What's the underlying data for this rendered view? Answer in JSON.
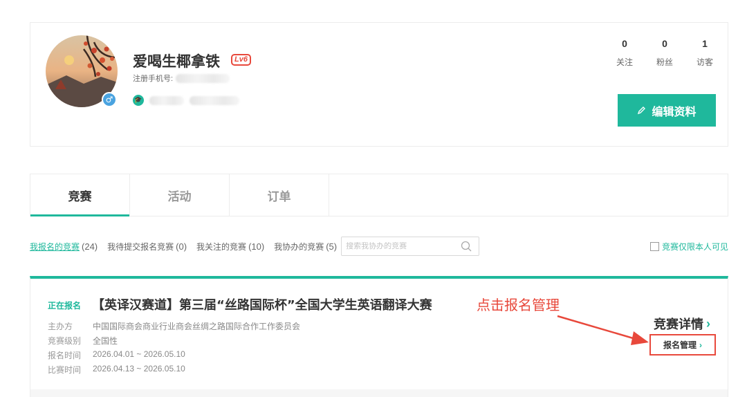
{
  "profile": {
    "username": "爱喝生椰拿铁",
    "level": "Lv6",
    "gender_symbol": "♂",
    "phone_label": "注册手机号:",
    "stats": [
      {
        "value": "0",
        "label": "关注"
      },
      {
        "value": "0",
        "label": "粉丝"
      },
      {
        "value": "1",
        "label": "访客"
      }
    ],
    "edit_button": "编辑资料"
  },
  "tabs": [
    {
      "label": "竞赛",
      "active": true
    },
    {
      "label": "活动",
      "active": false
    },
    {
      "label": "订单",
      "active": false
    }
  ],
  "filters": [
    {
      "label": "我报名的竞赛",
      "count": "(24)",
      "active": true
    },
    {
      "label": "我待提交报名竞赛",
      "count": "(0)",
      "active": false
    },
    {
      "label": "我关注的竞赛",
      "count": "(10)",
      "active": false
    },
    {
      "label": "我协办的竞赛",
      "count": "(5)",
      "active": false
    }
  ],
  "search": {
    "placeholder": "搜索我协办的竞赛"
  },
  "visibility_label": "竞赛仅限本人可见",
  "competition": {
    "status": "正在报名",
    "title": "【英译汉赛道】第三届“丝路国际杯”全国大学生英语翻译大赛",
    "organizer_label": "主办方",
    "organizer": "中国国际商会商业行业商会丝绸之路国际合作工作委员会",
    "level_label": "竞赛级别",
    "level": "全国性",
    "signup_label": "报名时间",
    "signup_time": "2026.04.01 ~ 2026.05.10",
    "match_label": "比赛时间",
    "match_time": "2026.04.13 ~ 2026.05.10",
    "detail_link": "竞赛详情",
    "manage_link": "报名管理",
    "annotation": "点击报名管理"
  },
  "colors": {
    "accent": "#1fb89c",
    "annotation": "#e8483b"
  }
}
